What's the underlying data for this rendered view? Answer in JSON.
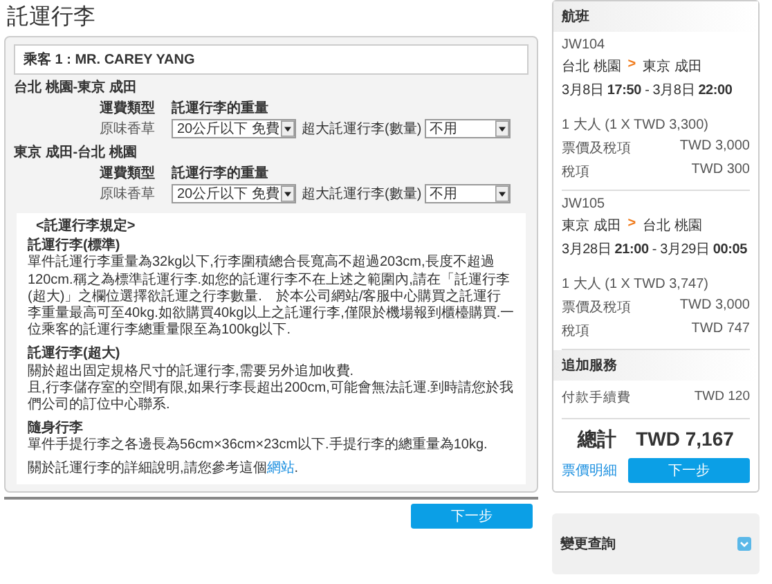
{
  "page_title": "託運行李",
  "passenger": "乘客 1 : MR. CAREY YANG",
  "segments": [
    {
      "route": "台北 桃園-東京 成田",
      "fare_type_label": "運費類型",
      "fare_type": "原味香草",
      "weight_label": "託運行李的重量",
      "weight_value": "20公斤以下 免費",
      "oversize_label": "超大託運行李(數量)",
      "oversize_value": "不用"
    },
    {
      "route": "東京 成田-台北 桃園",
      "fare_type_label": "運費類型",
      "fare_type": "原味香草",
      "weight_label": "託運行李的重量",
      "weight_value": "20公斤以下 免費",
      "oversize_label": "超大託運行李(數量)",
      "oversize_value": "不用"
    }
  ],
  "rules": {
    "heading": "<託運行李規定>",
    "sections": [
      {
        "title": "託運行李(標準)",
        "paragraphs": [
          "單件託運行李重量為32kg以下,行李圍積總合長寬高不超過203cm,長度不超過120cm.稱之為標準託運行李.如您的託運行李不在上述之範圍內,請在「託運行李(超大)」之欄位選擇欲託運之行李數量.　於本公司網站/客服中心購買之託運行李重量最高可至40kg.如欲購買40kg以上之託運行李,僅限於機場報到櫃檯購買.一位乘客的託運行李總重量限至為100kg以下."
        ]
      },
      {
        "title": "託運行李(超大)",
        "paragraphs": [
          "關於超出固定規格尺寸的託運行李,需要另外追加收費.",
          "且,行李儲存室的空間有限,如果行李長超出200cm,可能會無法託運.到時請您於我們公司的訂位中心聯系."
        ]
      },
      {
        "title": "隨身行李",
        "paragraphs": [
          "單件手提行李之各邊長為56cm×36cm×23cm以下.手提行李的總重量為10kg."
        ]
      }
    ],
    "footer_text": "關於託運行李的詳細說明,請您參考這個",
    "footer_link": "網站",
    "footer_end": "."
  },
  "next_button": "下一步",
  "sidebar": {
    "flights_header": "航班",
    "flights": [
      {
        "number": "JW104",
        "from": "台北 桃園",
        "arrow": ">",
        "to": "東京 成田",
        "times": "3月8日 **17:50** - 3月8日 **22:00**",
        "passengers": "1 大人 (1 X TWD 3,300)",
        "lines": [
          {
            "label": "票價及稅項",
            "amount": "TWD 3,000"
          },
          {
            "label": "稅項",
            "amount": "TWD 300"
          }
        ]
      },
      {
        "number": "JW105",
        "from": "東京 成田",
        "arrow": ">",
        "to": "台北 桃園",
        "times": "3月28日 **21:00** - 3月29日 **00:05**",
        "passengers": "1 大人 (1 X TWD 3,747)",
        "lines": [
          {
            "label": "票價及稅項",
            "amount": "TWD 3,000"
          },
          {
            "label": "稅項",
            "amount": "TWD 747"
          }
        ]
      }
    ],
    "extras_header": "追加服務",
    "extras": [
      {
        "label": "付款手續費",
        "amount": "TWD 120"
      }
    ],
    "total_label": "總計",
    "total": "TWD 7,167",
    "details_link": "票價明細",
    "next_button": "下一步"
  },
  "change_panel": {
    "title": "變更查詢"
  }
}
